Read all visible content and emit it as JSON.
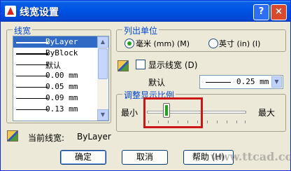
{
  "window": {
    "title": "线宽设置",
    "help_symbol": "?",
    "close_symbol": "×"
  },
  "lineweight_group": {
    "title": "线宽",
    "items": [
      {
        "label": "ByLayer",
        "selected": true
      },
      {
        "label": "ByBlock",
        "selected": false
      },
      {
        "label": "默认",
        "selected": false
      },
      {
        "label": "0.00 mm",
        "selected": false
      },
      {
        "label": "0.05 mm",
        "selected": false
      },
      {
        "label": "0.09 mm",
        "selected": false
      },
      {
        "label": "0.13 mm",
        "selected": false
      }
    ]
  },
  "units_group": {
    "title": "列出单位",
    "options": [
      {
        "label": "毫米 (mm) (M)",
        "selected": true
      },
      {
        "label": "英寸 (in) (I)",
        "selected": false
      }
    ]
  },
  "display_lineweight": {
    "label": "显示线宽 (D)",
    "checked": false
  },
  "default": {
    "label": "默认",
    "value": "0.25 mm"
  },
  "scale_group": {
    "title": "调整显示比例",
    "min_label": "最小",
    "max_label": "最大",
    "level": 0.2
  },
  "current_lineweight": {
    "label": "当前线宽:",
    "value": "ByLayer"
  },
  "buttons": {
    "ok": "确定",
    "cancel": "取消",
    "help": "帮助 (H)"
  },
  "watermark": "www.ttcad.com",
  "colors": {
    "title_bar": "#0055e5",
    "selection": "#316ac5",
    "group_title": "#0046d5",
    "highlight_box": "#cc1616",
    "radio_dot": "#21a121"
  }
}
